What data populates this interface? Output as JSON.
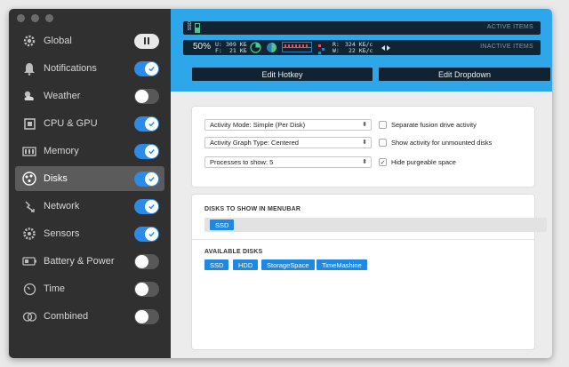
{
  "sidebar": {
    "items": [
      {
        "label": "Global",
        "icon": "gear-icon",
        "state": "pause"
      },
      {
        "label": "Notifications",
        "icon": "bell-icon",
        "state": "on"
      },
      {
        "label": "Weather",
        "icon": "weather-icon",
        "state": "off"
      },
      {
        "label": "CPU & GPU",
        "icon": "cpu-icon",
        "state": "on"
      },
      {
        "label": "Memory",
        "icon": "memory-icon",
        "state": "on"
      },
      {
        "label": "Disks",
        "icon": "disk-icon",
        "state": "on",
        "active": true
      },
      {
        "label": "Network",
        "icon": "network-icon",
        "state": "on"
      },
      {
        "label": "Sensors",
        "icon": "sensor-icon",
        "state": "on"
      },
      {
        "label": "Battery & Power",
        "icon": "battery-icon",
        "state": "off"
      },
      {
        "label": "Time",
        "icon": "clock-icon",
        "state": "off"
      },
      {
        "label": "Combined",
        "icon": "combined-icon",
        "state": "off"
      }
    ]
  },
  "preview": {
    "active_label": "ACTIVE ITEMS",
    "inactive_label": "INACTIVE ITEMS",
    "usage_percent": "50%",
    "used_label": "U:",
    "used_value": "309 KБ",
    "free_label": "F:",
    "free_value": "21 KБ",
    "read_label": "R:",
    "read_value": "324 KБ/с",
    "write_label": "W:",
    "write_value": "22 KБ/с",
    "ssd_vertical": "SSD"
  },
  "buttons": {
    "edit_hotkey": "Edit Hotkey",
    "edit_dropdown": "Edit Dropdown"
  },
  "settings": {
    "activity_mode": "Activity Mode: Simple (Per Disk)",
    "activity_graph": "Activity Graph Type: Centered",
    "processes": "Processes to show: 5",
    "separate_fusion": "Separate fusion drive activity",
    "show_unmounted": "Show activity for unmounted disks",
    "hide_purgeable": "Hide purgeable space",
    "separate_fusion_checked": false,
    "show_unmounted_checked": false,
    "hide_purgeable_checked": true
  },
  "disks": {
    "menubar_title": "DISKS TO SHOW IN MENUBAR",
    "menubar_disks": [
      "SSD"
    ],
    "available_title": "AVAILABLE DISKS",
    "available_disks": [
      "SSD",
      "HDD",
      "StorageSpace",
      "TimeMashine"
    ]
  },
  "colors": {
    "accent": "#2ea6ea",
    "toggle_on": "#2b8be6",
    "sidebar_bg": "#303030",
    "chip": "#1e88e5"
  }
}
